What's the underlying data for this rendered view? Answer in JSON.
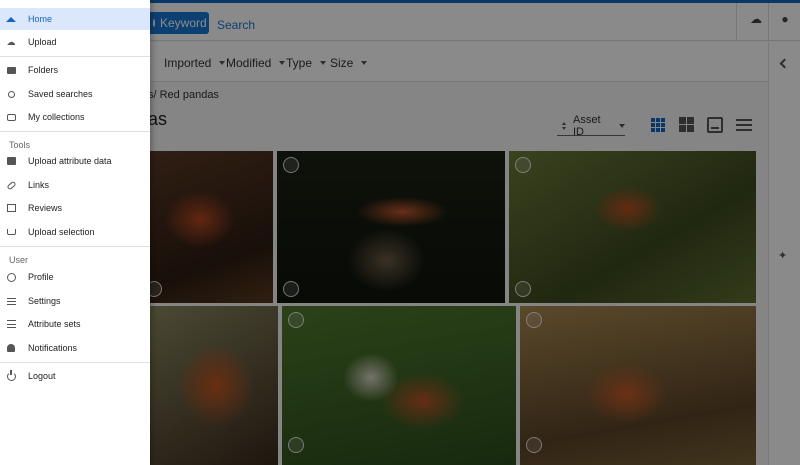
{
  "header": {
    "keyword_button": "Keyword",
    "search_link": "Search",
    "icons": [
      "upload-cloud-icon",
      "account-icon"
    ]
  },
  "filters": [
    {
      "label": "Imported"
    },
    {
      "label": "Modified"
    },
    {
      "label": "Type"
    },
    {
      "label": "Size"
    }
  ],
  "main": {
    "breadcrumb": "s/ Red pandas",
    "title": "as",
    "sort": {
      "label": "Asset ID"
    },
    "views": [
      "grid-view-icon",
      "tiles-view-icon",
      "single-view-icon",
      "list-view-icon"
    ],
    "active_view": "grid",
    "images": [
      "red panda sleeping on branch",
      "red panda on barrel",
      "red panda resting in tree",
      "red panda close-up",
      "red panda among leaves",
      "red panda on log"
    ]
  },
  "colors": {
    "accent": "#1565c0",
    "active_bg": "#dbe7fb",
    "overlay": "rgba(0,0,0,0.46)"
  },
  "drawer": {
    "items": [
      {
        "label": "Home",
        "icon": "home-icon",
        "active": true
      },
      {
        "label": "Upload",
        "icon": "cloud-upload-icon"
      },
      {
        "label": "Folders",
        "icon": "folder-icon"
      },
      {
        "label": "Saved searches",
        "icon": "search-icon"
      },
      {
        "label": "My collections",
        "icon": "inbox-icon"
      }
    ],
    "tools_label": "Tools",
    "tools": [
      {
        "label": "Upload attribute data",
        "icon": "box-icon"
      },
      {
        "label": "Links",
        "icon": "link-icon"
      },
      {
        "label": "Reviews",
        "icon": "table-icon"
      },
      {
        "label": "Upload selection",
        "icon": "cart-icon"
      }
    ],
    "user_label": "User",
    "user": [
      {
        "label": "Profile",
        "icon": "account-circle-icon"
      },
      {
        "label": "Settings",
        "icon": "sliders-icon"
      },
      {
        "label": "Attribute sets",
        "icon": "list-icon"
      },
      {
        "label": "Notifications",
        "icon": "bell-icon"
      }
    ],
    "logout": {
      "label": "Logout",
      "icon": "power-icon"
    }
  }
}
